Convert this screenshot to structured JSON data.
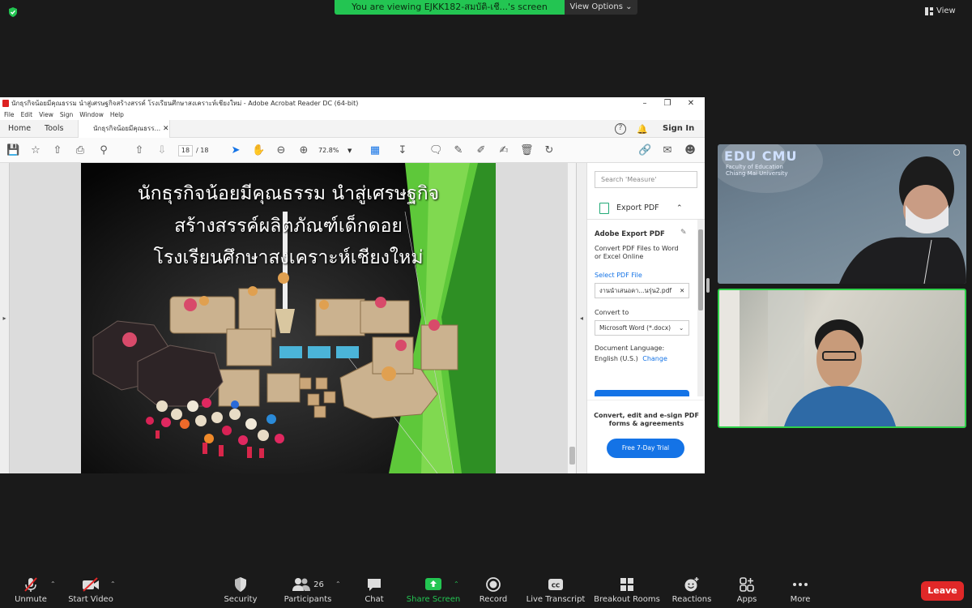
{
  "banner": {
    "text": "You are viewing EJKK182-สมบัติ-เชี...'s screen",
    "view_options": "View Options",
    "view": "View"
  },
  "acrobat": {
    "title": "นักธุรกิจน้อยมีคุณธรรม  นำสู่เศรษฐกิจสร้างสรรค์ โรงเรียนศึกษาสงเคราะห์เชียงใหม่ - Adobe Acrobat Reader DC (64-bit)",
    "menu": [
      "File",
      "Edit",
      "View",
      "Sign",
      "Window",
      "Help"
    ],
    "tabs": {
      "home": "Home",
      "tools": "Tools",
      "doc": "นักธุรกิจน้อยมีคุณธรร..."
    },
    "sign_in": "Sign In",
    "page_current": "18",
    "page_total": "/ 18",
    "zoom": "72.8%",
    "slide": {
      "line1": "นักธุรกิจน้อยมีคุณธรรม   นำสู่เศรษฐกิจ",
      "line2": "สร้างสรรค์ผลิตภัณฑ์เด็กดอย",
      "line3": "โรงเรียนศึกษาสงเคราะห์เชียงใหม่"
    },
    "pane": {
      "search_placeholder": "Search 'Measure'",
      "export_title": "Export PDF",
      "adobe_export": "Adobe Export PDF",
      "convert_desc": "Convert PDF Files to Word or Excel Online",
      "select_pdf": "Select PDF File",
      "file_name": "งานนำเสนอคา...นรุ่น2.pdf",
      "convert_to": "Convert to",
      "format": "Microsoft Word (*.docx)",
      "doc_lang_label": "Document Language:",
      "doc_lang": "English (U.S.)",
      "change": "Change",
      "convert_edit": "Convert, edit and e-sign PDF forms & agreements",
      "trial": "Free 7-Day Trial"
    }
  },
  "video": {
    "logo": "EDU CMU",
    "faculty": "Faculty of Education",
    "university": "Chiang Mai University"
  },
  "toolbar": {
    "unmute": "Unmute",
    "start_video": "Start Video",
    "security": "Security",
    "participants": "Participants",
    "participants_count": "26",
    "chat": "Chat",
    "share_screen": "Share Screen",
    "record": "Record",
    "live_transcript": "Live Transcript",
    "breakout_rooms": "Breakout Rooms",
    "reactions": "Reactions",
    "apps": "Apps",
    "more": "More",
    "leave": "Leave"
  },
  "colors": {
    "banner": "#23c552",
    "share_green": "#23c552",
    "leave_red": "#e02828",
    "acrobat_blue": "#1473e6",
    "active_speaker": "#2fd14a"
  }
}
